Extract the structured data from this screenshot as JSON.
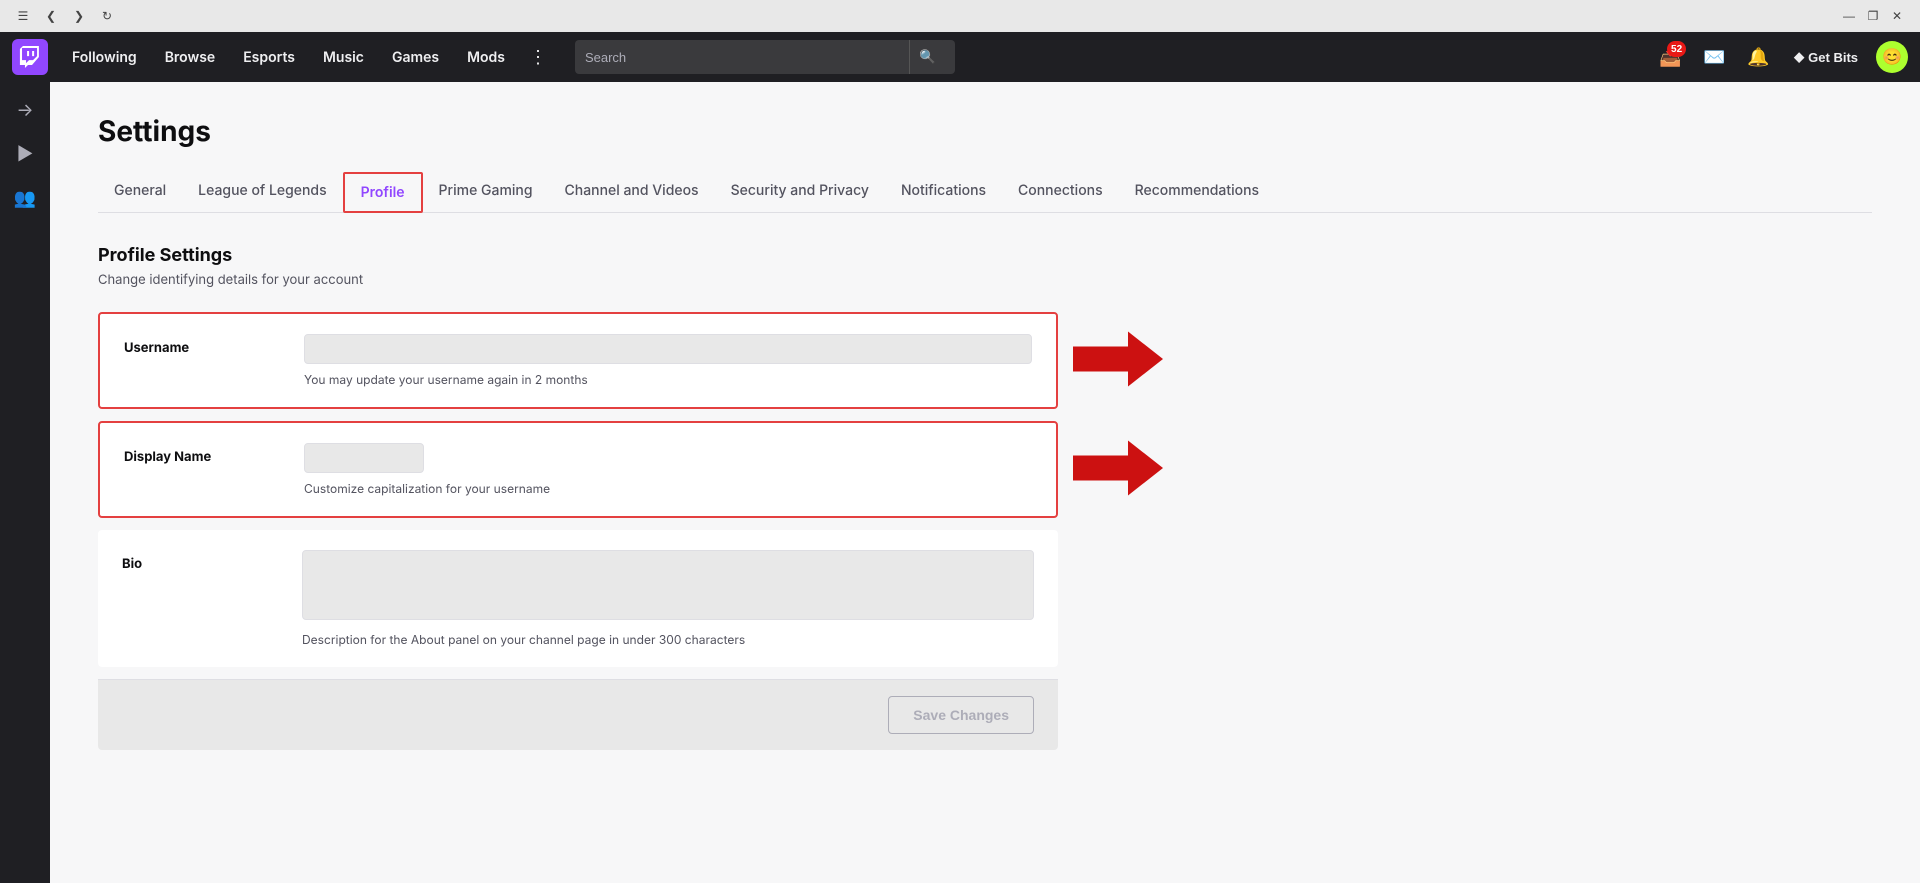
{
  "titlebar": {
    "back_btn": "❮",
    "forward_btn": "❯",
    "reload_btn": "↻",
    "menu_btn": "☰",
    "minimize_btn": "—",
    "maximize_btn": "❐",
    "close_btn": "✕"
  },
  "navbar": {
    "logo_alt": "Twitch",
    "links": [
      {
        "id": "following",
        "label": "Following"
      },
      {
        "id": "browse",
        "label": "Browse"
      },
      {
        "id": "esports",
        "label": "Esports"
      },
      {
        "id": "music",
        "label": "Music"
      },
      {
        "id": "games",
        "label": "Games"
      },
      {
        "id": "mods",
        "label": "Mods"
      }
    ],
    "search_placeholder": "Search",
    "notification_badge": "52",
    "get_bits_label": "Get Bits"
  },
  "sidebar": {
    "icons": [
      {
        "id": "collapse",
        "symbol": "→|"
      },
      {
        "id": "video",
        "symbol": "▶"
      },
      {
        "id": "friends",
        "symbol": "👥"
      }
    ]
  },
  "settings": {
    "page_title": "Settings",
    "tabs": [
      {
        "id": "general",
        "label": "General",
        "active": false
      },
      {
        "id": "league",
        "label": "League of Legends",
        "active": false
      },
      {
        "id": "profile",
        "label": "Profile",
        "active": true
      },
      {
        "id": "prime",
        "label": "Prime Gaming",
        "active": false
      },
      {
        "id": "channel",
        "label": "Channel and Videos",
        "active": false
      },
      {
        "id": "security",
        "label": "Security and Privacy",
        "active": false
      },
      {
        "id": "notifications",
        "label": "Notifications",
        "active": false
      },
      {
        "id": "connections",
        "label": "Connections",
        "active": false
      },
      {
        "id": "recommendations",
        "label": "Recommendations",
        "active": false
      }
    ],
    "profile": {
      "section_title": "Profile Settings",
      "section_subtitle": "Change identifying details for your account",
      "username_label": "Username",
      "username_value": "",
      "username_hint": "You may update your username again in 2 months",
      "display_name_label": "Display Name",
      "display_name_value": "",
      "display_name_hint": "Customize capitalization for your username",
      "bio_label": "Bio",
      "bio_value": "",
      "bio_hint": "Description for the About panel on your channel page in under 300 characters",
      "save_btn_label": "Save Changes"
    }
  },
  "colors": {
    "accent": "#9147ff",
    "red_highlight": "#e44040",
    "arrow_red": "#cc0000"
  }
}
